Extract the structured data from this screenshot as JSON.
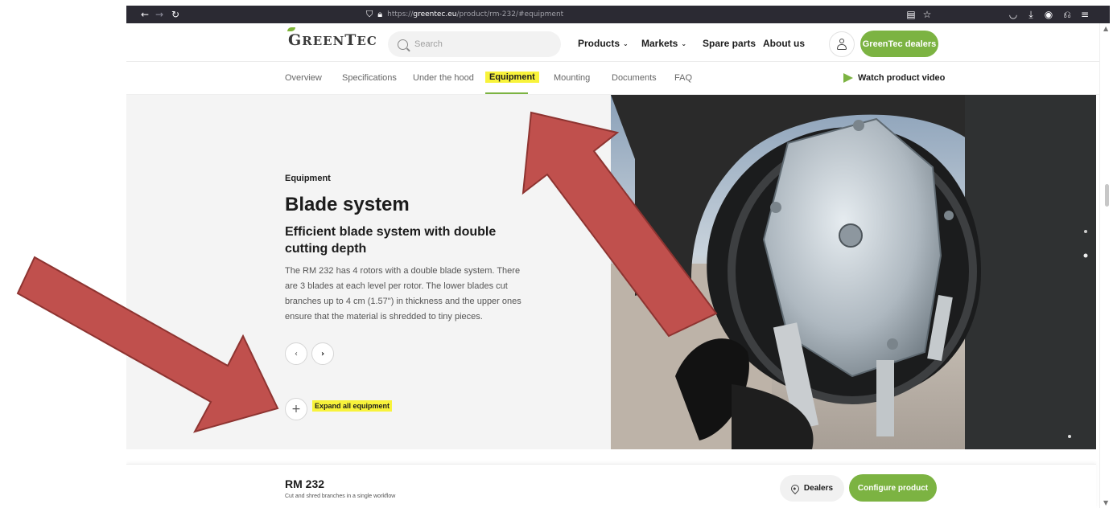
{
  "browser": {
    "url_prefix": "https://",
    "url_host": "greentec.eu",
    "url_path": "/product/rm-232/#equipment"
  },
  "header": {
    "logo_text": "GreenTec",
    "search_placeholder": "Search",
    "nav": [
      {
        "label": "Products",
        "has_dropdown": true
      },
      {
        "label": "Markets",
        "has_dropdown": true
      },
      {
        "label": "Spare parts",
        "has_dropdown": false
      },
      {
        "label": "About us",
        "has_dropdown": false
      }
    ],
    "dealers_button": "GreenTec dealers"
  },
  "subnav": {
    "tabs": [
      "Overview",
      "Specifications",
      "Under the hood",
      "Equipment",
      "Mounting",
      "Documents",
      "FAQ"
    ],
    "active_tab": "Equipment",
    "video_link": "Watch product video"
  },
  "content": {
    "eyebrow": "Equipment",
    "title": "Blade system",
    "subtitle": "Efficient blade system with double cutting depth",
    "description": "The RM 232 has 4 rotors with a double blade system. There are 3 blades at each level per rotor. The lower blades cut branches up to 4 cm (1.57\") in thickness and the upper ones ensure that the material is shredded to tiny pieces.",
    "prev_icon": "‹",
    "next_icon": "›",
    "expand_icon": "+",
    "expand_label": "Expand all equipment"
  },
  "footer_bar": {
    "model": "RM 232",
    "model_subtitle": "Cut and shred branches in a single workflow",
    "dealers_button": "Dealers",
    "configure_button": "Configure product"
  },
  "colors": {
    "brand_green": "#7cb342",
    "highlight_yellow": "#f8f33b",
    "annotation_arrow": "#c0504d"
  }
}
